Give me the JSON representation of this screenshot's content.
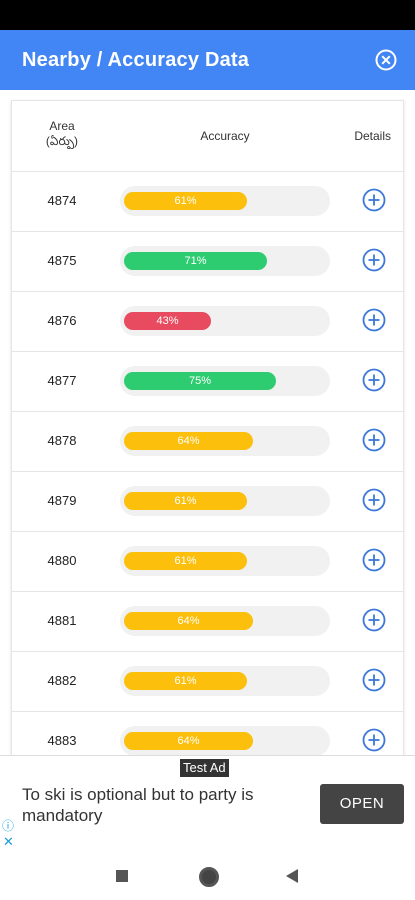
{
  "appbar": {
    "title": "Nearby / Accuracy Data",
    "close_icon": "close-circle-icon"
  },
  "table": {
    "headers": {
      "area": "Area\n(ఏర్పు)",
      "accuracy": "Accuracy",
      "details": "Details"
    },
    "rows": [
      {
        "area": "4874",
        "accuracy": 61,
        "label": "61%",
        "status": "medium"
      },
      {
        "area": "4875",
        "accuracy": 71,
        "label": "71%",
        "status": "high"
      },
      {
        "area": "4876",
        "accuracy": 43,
        "label": "43%",
        "status": "low"
      },
      {
        "area": "4877",
        "accuracy": 75,
        "label": "75%",
        "status": "high"
      },
      {
        "area": "4878",
        "accuracy": 64,
        "label": "64%",
        "status": "medium"
      },
      {
        "area": "4879",
        "accuracy": 61,
        "label": "61%",
        "status": "medium"
      },
      {
        "area": "4880",
        "accuracy": 61,
        "label": "61%",
        "status": "medium"
      },
      {
        "area": "4881",
        "accuracy": 64,
        "label": "64%",
        "status": "medium"
      },
      {
        "area": "4882",
        "accuracy": 61,
        "label": "61%",
        "status": "medium"
      },
      {
        "area": "4883",
        "accuracy": 64,
        "label": "64%",
        "status": "medium"
      }
    ]
  },
  "colors": {
    "appbar": "#4285f4",
    "high": "#2ecc71",
    "medium": "#fbbf0c",
    "low": "#e84a5f",
    "plus_icon": "#3b78d8"
  },
  "ad": {
    "badge": "Test Ad",
    "text": "To ski is optional but to party is mandatory",
    "button": "OPEN",
    "info_icon": "ⓘ",
    "close_icon": "✕"
  },
  "navbar": {
    "recents_icon": "square-icon",
    "home_icon": "circle-home-icon",
    "back_icon": "back-triangle-icon"
  }
}
